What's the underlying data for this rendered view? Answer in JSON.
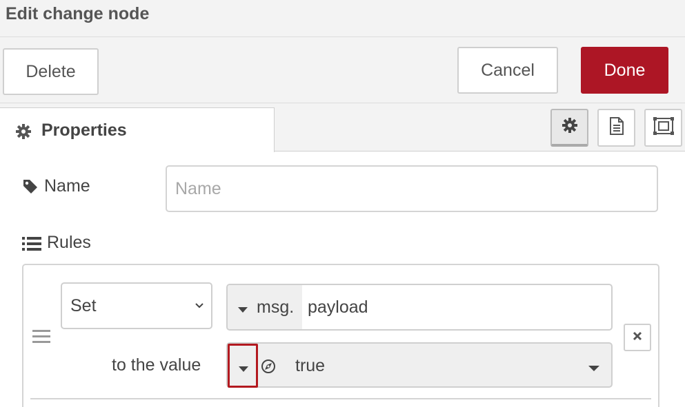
{
  "dialog": {
    "title": "Edit change node"
  },
  "toolbar": {
    "delete_label": "Delete",
    "cancel_label": "Cancel",
    "done_label": "Done",
    "done_color": "#ad1625"
  },
  "tabs": {
    "active_label": "Properties",
    "active_icon": "gear-icon",
    "icon_buttons": [
      "gear-icon",
      "document-icon",
      "frame-icon"
    ]
  },
  "form": {
    "name_label": "Name",
    "name_icon": "tag-icon",
    "name_value": "",
    "name_placeholder": "Name",
    "rules_label": "Rules",
    "rules_icon": "list-icon"
  },
  "rule": {
    "action": "Set",
    "property_prefix": "msg.",
    "property_value": "payload",
    "to_label": "to the value",
    "value_type_icon": "boolean-icon",
    "value": "true",
    "highlight_color": "#b3191f"
  }
}
